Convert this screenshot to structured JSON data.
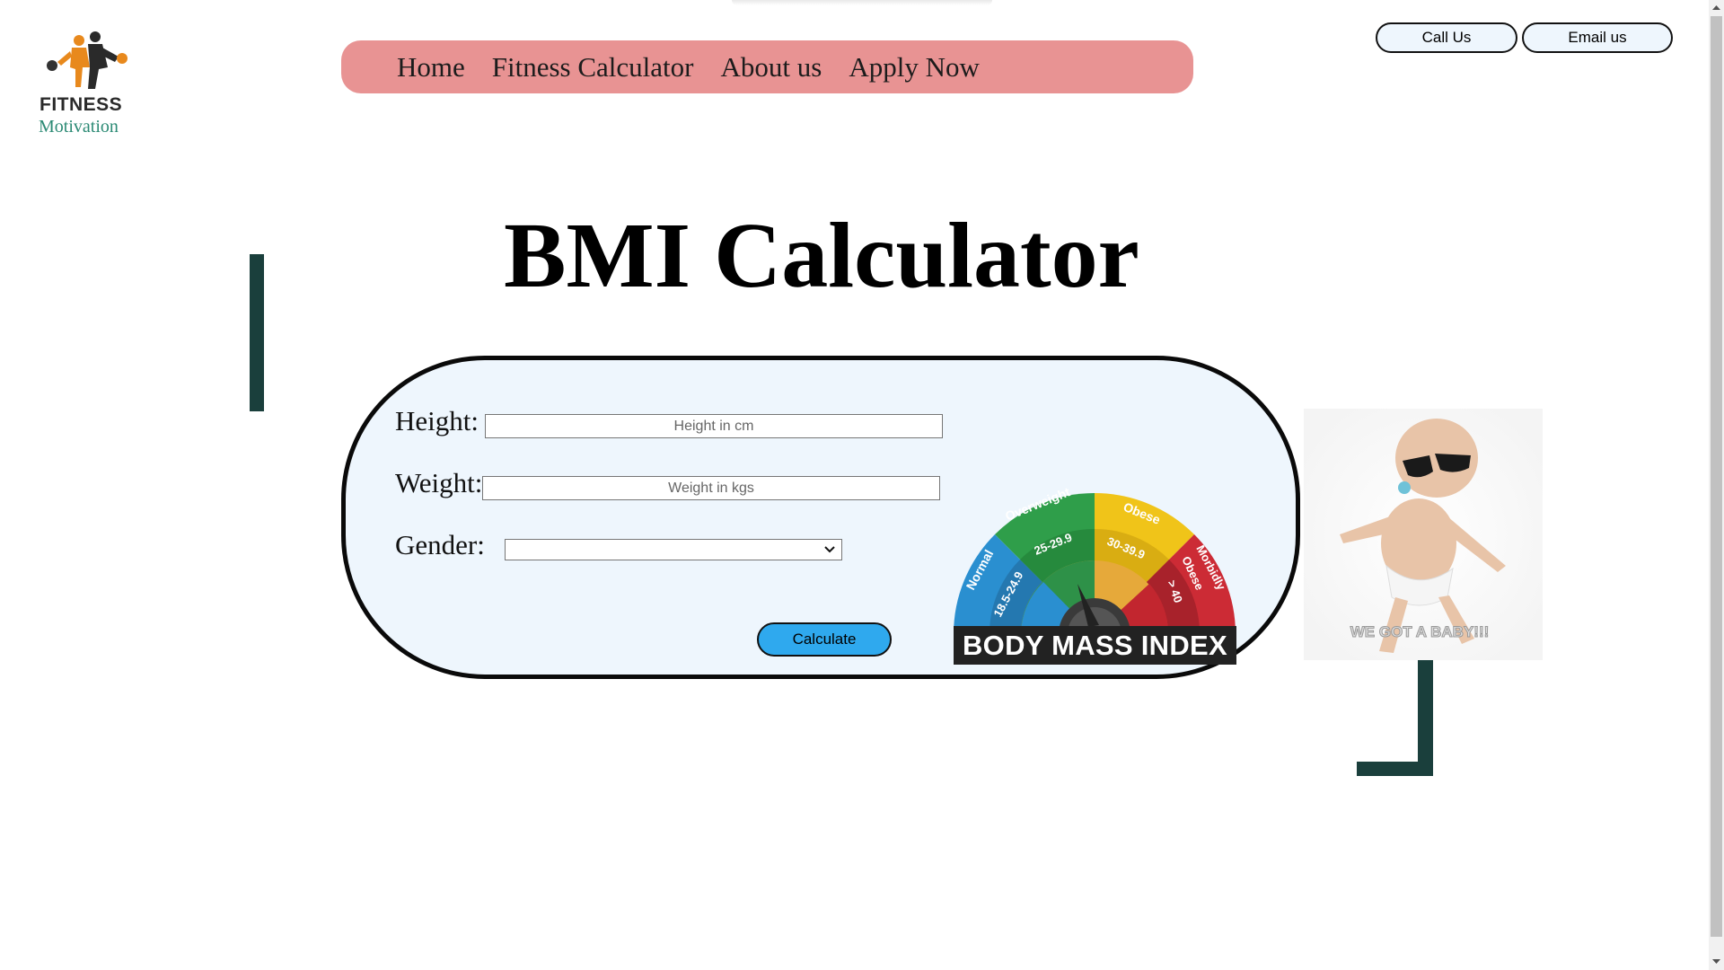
{
  "logo": {
    "word": "FITNESS",
    "sub": "Motivation"
  },
  "nav": {
    "items": [
      "Home",
      "Fitness Calculator",
      "About us",
      "Apply Now"
    ]
  },
  "contact": {
    "call_label": "Call Us",
    "email_label": "Email us"
  },
  "page": {
    "title": "BMI Calculator"
  },
  "form": {
    "height_label": "Height:",
    "height_placeholder": "Height in cm",
    "weight_label": "Weight:",
    "weight_placeholder": "Weight in kgs",
    "gender_label": "Gender:",
    "gender_value": "",
    "calculate_label": "Calculate"
  },
  "gauge": {
    "caption": "BODY MASS INDEX",
    "segments": [
      {
        "name": "Normal",
        "range": "18.5-24.9",
        "color": "#2a8fd0"
      },
      {
        "name": "Overweight",
        "range": "25-29.9",
        "color": "#2f9e4a"
      },
      {
        "name": "Obese",
        "range": "30-39.9",
        "color": "#f0c419"
      },
      {
        "name": "Morbidly Obese",
        "range": "> 40",
        "color": "#cc2b35"
      }
    ]
  },
  "baby": {
    "caption": "WE GOT A BABY!!!"
  },
  "colors": {
    "nav_bg": "#e89393",
    "panel_bg": "#eef6fd",
    "accent_button": "#2fa9ee",
    "deco_bar": "#1a3f3c"
  }
}
